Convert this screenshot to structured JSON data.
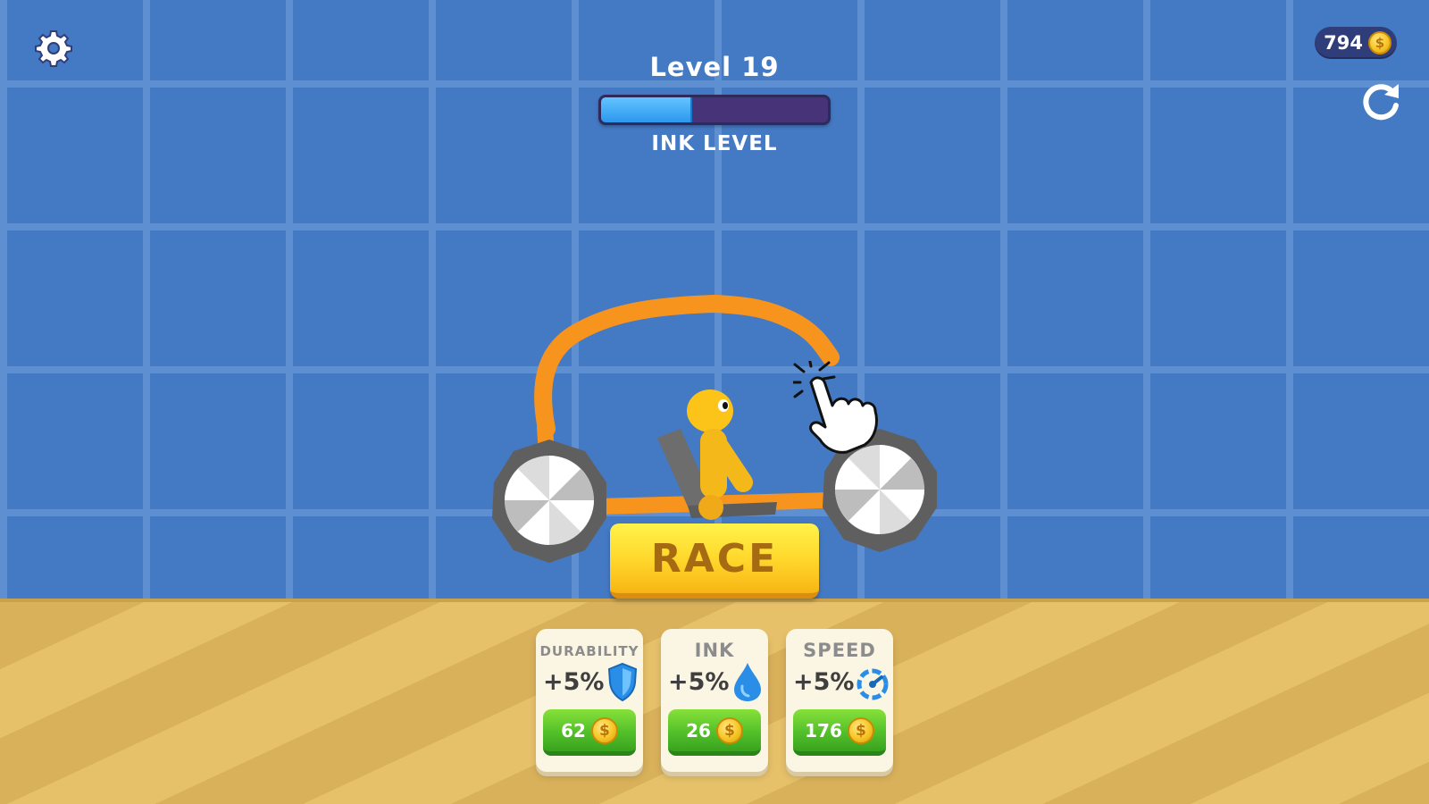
{
  "hud": {
    "level": "Level 19",
    "ink_label": "INK LEVEL",
    "ink_fill_fraction": 0.4,
    "coins": "794",
    "coin_symbol": "$"
  },
  "buttons": {
    "race_label": "RACE"
  },
  "upgrades": [
    {
      "title": "DURABILITY",
      "bonus": "+5%",
      "price": "62",
      "icon": "shield-icon"
    },
    {
      "title": "INK",
      "bonus": "+5%",
      "price": "26",
      "icon": "ink-drop-icon"
    },
    {
      "title": "SPEED",
      "bonus": "+5%",
      "price": "176",
      "icon": "speedometer-icon"
    }
  ],
  "colors": {
    "sky": "#4479c3",
    "grid": "#5e8fd0",
    "ground": "#e3bd64",
    "ink_fill": "#2c97ee",
    "ink_track": "#473377",
    "car_line": "#f7941d",
    "race_button": "#ffd52a",
    "buy_button": "#52c02a"
  }
}
